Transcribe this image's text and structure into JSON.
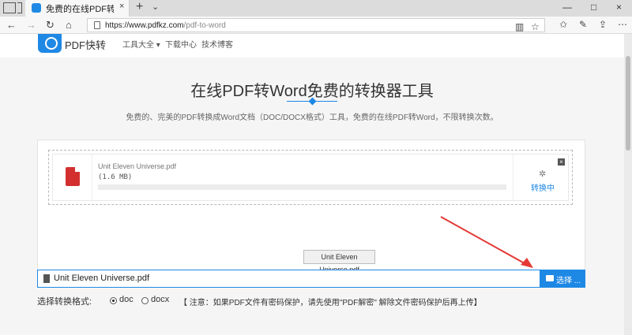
{
  "browser": {
    "tab_title": "免费的在线PDF转Word-",
    "tab_close": "×",
    "new_tab": "+",
    "tab_list": "⌄",
    "url_host": "https://www.pdfkz.com",
    "url_path": "/pdf-to-word",
    "win_min": "—",
    "win_max": "□",
    "win_close": "×"
  },
  "header": {
    "brand": "PDF快转",
    "nav": [
      "工具大全 ▾",
      "下载中心",
      "技术博客"
    ]
  },
  "hero": {
    "title": "在线PDF转Word免费的转换器工具",
    "subtitle": "免费的、完美的PDF转换成Word文档（DOC/DOCX格式）工具，免费的在线PDF转Word，不限转换次数。"
  },
  "file_card": {
    "file_name": "Unit Eleven Universe.pdf",
    "file_size": "(1.6 MB)",
    "progress_fraction": 0,
    "status": "转换中",
    "close": "×"
  },
  "tooltip": "Unit Eleven Universe.pdf",
  "file_input": {
    "value": "Unit Eleven Universe.pdf",
    "button": "选择 ..."
  },
  "format": {
    "label": "选择转换格式:",
    "options": [
      "doc",
      "docx"
    ],
    "selected": "doc",
    "notice": "【 注意：如果PDF文件有密码保护，请先使用\"PDF解密\" 解除文件密码保护后再上传】"
  },
  "colors": {
    "accent": "#1e88e5",
    "pdf_red": "#d32f2f",
    "arrow": "#e53935"
  }
}
